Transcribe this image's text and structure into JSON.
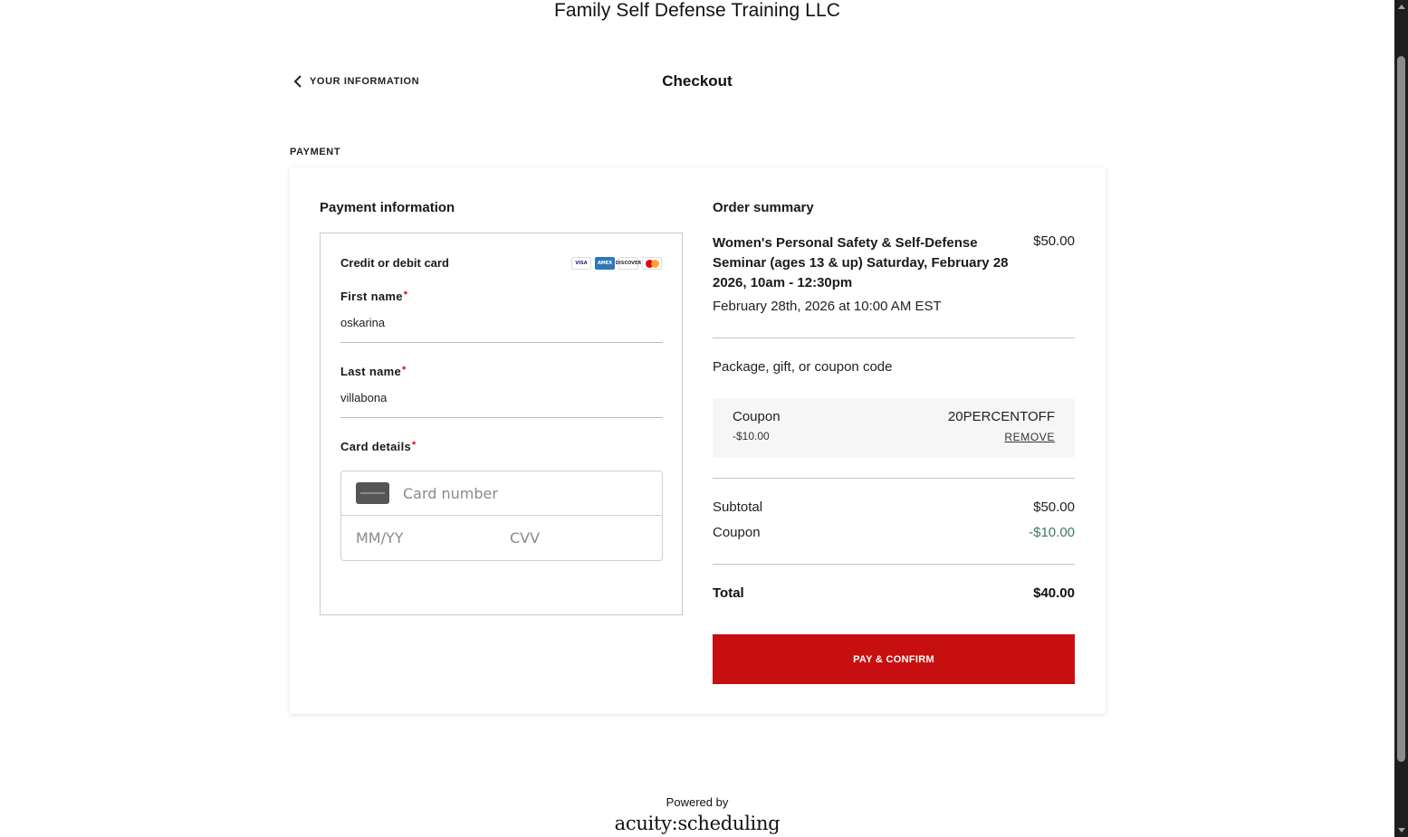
{
  "business_name": "Family Self Defense Training LLC",
  "nav": {
    "back_label": "YOUR INFORMATION",
    "page_title": "Checkout"
  },
  "section_label": "PAYMENT",
  "payment": {
    "title": "Payment information",
    "method_label": "Credit or debit card",
    "card_brands": [
      "VISA",
      "AMEX",
      "DISCOVER",
      "mastercard"
    ],
    "first_name_label": "First name",
    "first_name_value": "oskarina",
    "last_name_label": "Last name",
    "last_name_value": "villabona",
    "card_details_label": "Card details",
    "required_mark": "*",
    "card_number_placeholder": "Card number",
    "expiry_placeholder": "MM/YY",
    "cvv_placeholder": "CVV"
  },
  "order": {
    "title": "Order summary",
    "item_name": "Women's Personal Safety & Self-Defense Seminar (ages 13 & up) Saturday, February 28 2026, 10am - 12:30pm",
    "item_price": "$50.00",
    "item_datetime": "February 28th, 2026 at 10:00 AM EST",
    "coupon_prompt": "Package, gift, or coupon code",
    "coupon_label": "Coupon",
    "coupon_amount": "-$10.00",
    "coupon_code": "20PERCENTOFF",
    "coupon_remove": "REMOVE",
    "subtotal_label": "Subtotal",
    "subtotal_value": "$50.00",
    "coupon_line_label": "Coupon",
    "coupon_line_value": "-$10.00",
    "total_label": "Total",
    "total_value": "$40.00",
    "pay_button": "PAY & CONFIRM"
  },
  "footer": {
    "powered_by": "Powered by",
    "brand": "acuity:scheduling"
  },
  "colors": {
    "accent": "#c80f10",
    "discount": "#3d7a5c",
    "required": "#cc1010"
  }
}
